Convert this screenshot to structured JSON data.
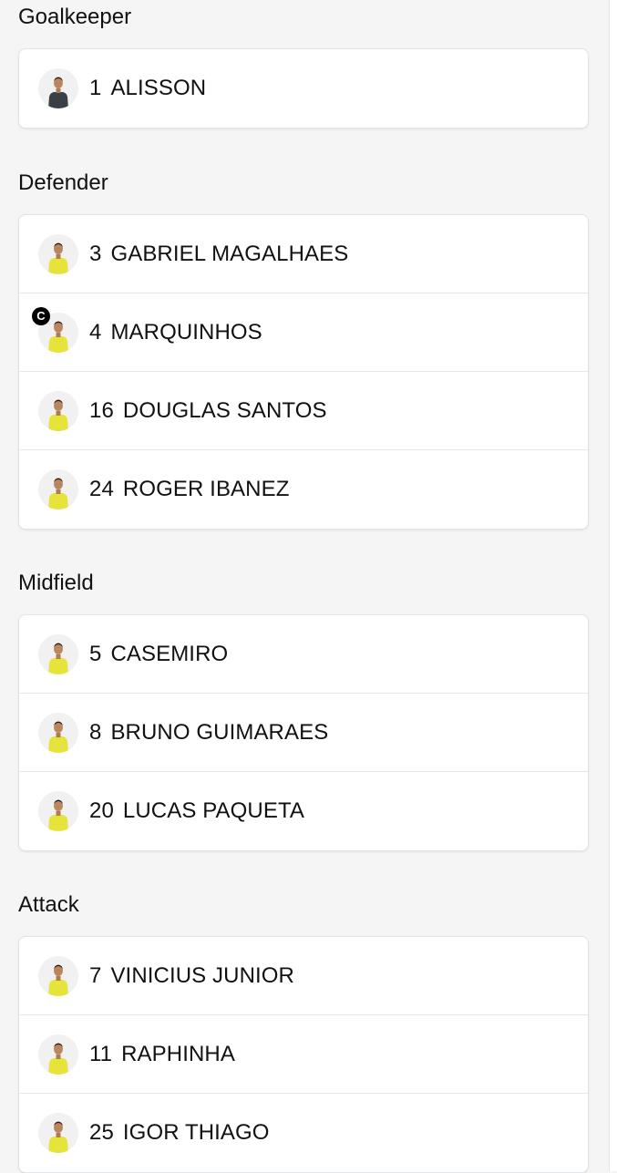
{
  "colors": {
    "page_background": "#f5f5f6",
    "card_background": "#ffffff",
    "text": "#111111",
    "kit_yellow": "#e6e33a",
    "keeper_kit": "#3b3f46",
    "captain_badge": "#000000"
  },
  "captain_badge_label": "C",
  "sections": [
    {
      "title": "Goalkeeper",
      "players": [
        {
          "number": "1",
          "name": "ALISSON",
          "avatar_icon": "player-photo-icon",
          "kit": "dark",
          "captain": false
        }
      ]
    },
    {
      "title": "Defender",
      "players": [
        {
          "number": "3",
          "name": "GABRIEL MAGALHAES",
          "avatar_icon": "player-photo-icon",
          "kit": "yellow",
          "captain": false
        },
        {
          "number": "4",
          "name": "MARQUINHOS",
          "avatar_icon": "player-photo-icon",
          "kit": "yellow",
          "captain": true
        },
        {
          "number": "16",
          "name": "DOUGLAS SANTOS",
          "avatar_icon": "player-photo-icon",
          "kit": "yellow",
          "captain": false
        },
        {
          "number": "24",
          "name": "ROGER IBANEZ",
          "avatar_icon": "player-photo-icon",
          "kit": "yellow",
          "captain": false
        }
      ]
    },
    {
      "title": "Midfield",
      "players": [
        {
          "number": "5",
          "name": "CASEMIRO",
          "avatar_icon": "player-photo-icon",
          "kit": "yellow",
          "captain": false
        },
        {
          "number": "8",
          "name": "BRUNO GUIMARAES",
          "avatar_icon": "player-photo-icon",
          "kit": "yellow",
          "captain": false
        },
        {
          "number": "20",
          "name": "LUCAS PAQUETA",
          "avatar_icon": "player-photo-icon",
          "kit": "yellow",
          "captain": false
        }
      ]
    },
    {
      "title": "Attack",
      "players": [
        {
          "number": "7",
          "name": "VINICIUS JUNIOR",
          "avatar_icon": "player-photo-icon",
          "kit": "yellow",
          "captain": false
        },
        {
          "number": "11",
          "name": "RAPHINHA",
          "avatar_icon": "player-photo-icon",
          "kit": "yellow",
          "captain": false
        },
        {
          "number": "25",
          "name": "IGOR THIAGO",
          "avatar_icon": "player-photo-icon",
          "kit": "yellow",
          "captain": false
        }
      ]
    }
  ]
}
